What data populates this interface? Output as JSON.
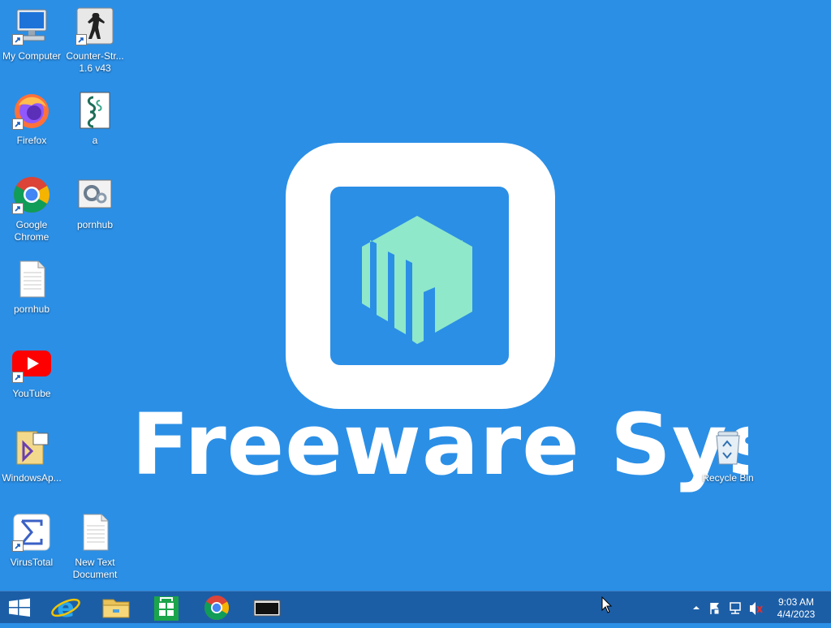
{
  "wallpaper": {
    "text": "Freeware Sys"
  },
  "desktop": {
    "icons": [
      {
        "label": "My Computer"
      },
      {
        "label": "Counter-Str... 1.6 v43"
      },
      {
        "label": "Firefox"
      },
      {
        "label": "a"
      },
      {
        "label": "Google Chrome"
      },
      {
        "label": "pornhub"
      },
      {
        "label": "pornhub"
      },
      {
        "label": "YouTube"
      },
      {
        "label": "WindowsAp..."
      },
      {
        "label": "VirusTotal"
      },
      {
        "label": "New Text Document"
      },
      {
        "label": "Recycle Bin"
      }
    ]
  },
  "taskbar": {
    "pinned": [
      "start-icon",
      "internet-explorer-icon",
      "file-explorer-icon",
      "store-icon",
      "chrome-icon",
      "terminal-icon"
    ],
    "clock": {
      "time": "9:03 AM",
      "date": "4/4/2023"
    },
    "tray": [
      "show-hidden-icons",
      "action-center-flag-icon",
      "network-icon",
      "volume-muted-icon"
    ]
  },
  "colors": {
    "desktop": "#2b8fe6",
    "taskbar": "#1c5ea6",
    "logo_mint": "#8fe8c9"
  }
}
